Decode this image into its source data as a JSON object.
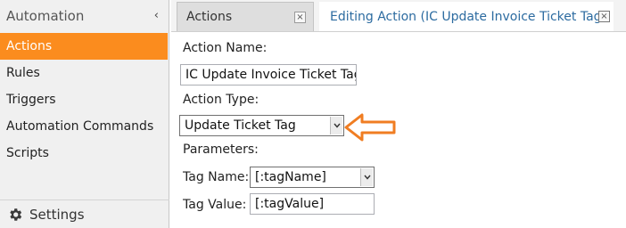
{
  "sidebar": {
    "header": "Automation",
    "collapse_glyph": "‹",
    "items": [
      {
        "label": "Actions",
        "active": true
      },
      {
        "label": "Rules"
      },
      {
        "label": "Triggers"
      },
      {
        "label": "Automation Commands"
      },
      {
        "label": "Scripts"
      }
    ],
    "footer_label": "Settings",
    "footer_icon": "gear-icon",
    "accent_color": "#fb8c1e"
  },
  "tabs": [
    {
      "label": "Actions",
      "close": "×"
    },
    {
      "label": "Editing Action (IC Update Invoice Ticket Tag)",
      "close": "×"
    }
  ],
  "form": {
    "action_name_label": "Action Name:",
    "action_name_value": "IC Update Invoice Ticket Tag",
    "action_type_label": "Action Type:",
    "action_type_value": "Update Ticket Tag",
    "parameters_label": "Parameters:",
    "tag_name_label": "Tag Name:",
    "tag_name_value": "[:tagName]",
    "tag_value_label": "Tag Value:",
    "tag_value_value": "[:tagValue]"
  },
  "annotation": {
    "icon": "arrow-left-icon",
    "color": "#f07d22"
  }
}
